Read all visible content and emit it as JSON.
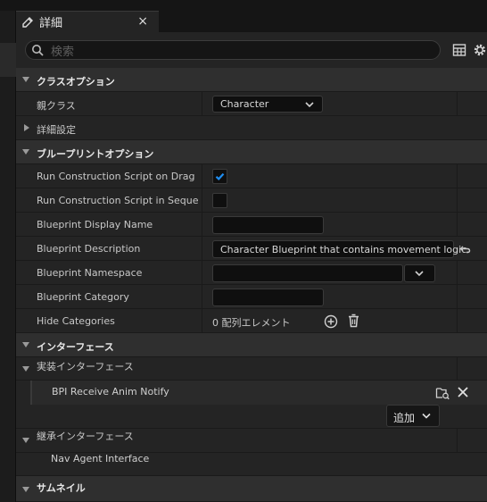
{
  "tab": {
    "title": "詳細",
    "close": "×"
  },
  "search": {
    "placeholder": "検索"
  },
  "icons": {
    "tab": "details-icon",
    "search": "search-icon",
    "view": "table-view-icon",
    "settings": "gear-icon",
    "reset": "reset-arrow-icon",
    "add": "plus-circle-icon",
    "delete": "trash-icon",
    "browse": "browse-asset-icon",
    "remove": "close-icon",
    "dropdown": "chevron-down-icon"
  },
  "class_options": {
    "header": "クラスオプション",
    "parent_class_label": "親クラス",
    "parent_class_value": "Character",
    "advanced_label": "詳細設定"
  },
  "blueprint_options": {
    "header": "ブループリントオプション",
    "rows": {
      "run_construction_drag": {
        "label": "Run Construction Script on Drag",
        "checked": true
      },
      "run_construction_sequencer": {
        "label": "Run Construction Script in Sequen...",
        "checked": false
      },
      "display_name": {
        "label": "Blueprint Display Name",
        "value": ""
      },
      "description": {
        "label": "Blueprint Description",
        "value": "Character Blueprint that contains movement logic."
      },
      "namespace": {
        "label": "Blueprint Namespace",
        "value": ""
      },
      "category": {
        "label": "Blueprint Category",
        "value": ""
      },
      "hide_categories": {
        "label": "Hide Categories",
        "value": "0 配列エレメント"
      }
    }
  },
  "interfaces": {
    "header": "インターフェース",
    "implemented_label": "実装インターフェース",
    "implemented": [
      "BPI Receive Anim Notify"
    ],
    "add_label": "追加",
    "inherited_label": "継承インターフェース",
    "inherited": [
      "Nav Agent Interface"
    ]
  },
  "thumbnail": {
    "header": "サムネイル"
  },
  "colors": {
    "accent": "#1f8ef1",
    "panel": "#242424",
    "category": "#2f2f2f",
    "input": "#0f0f0f"
  }
}
